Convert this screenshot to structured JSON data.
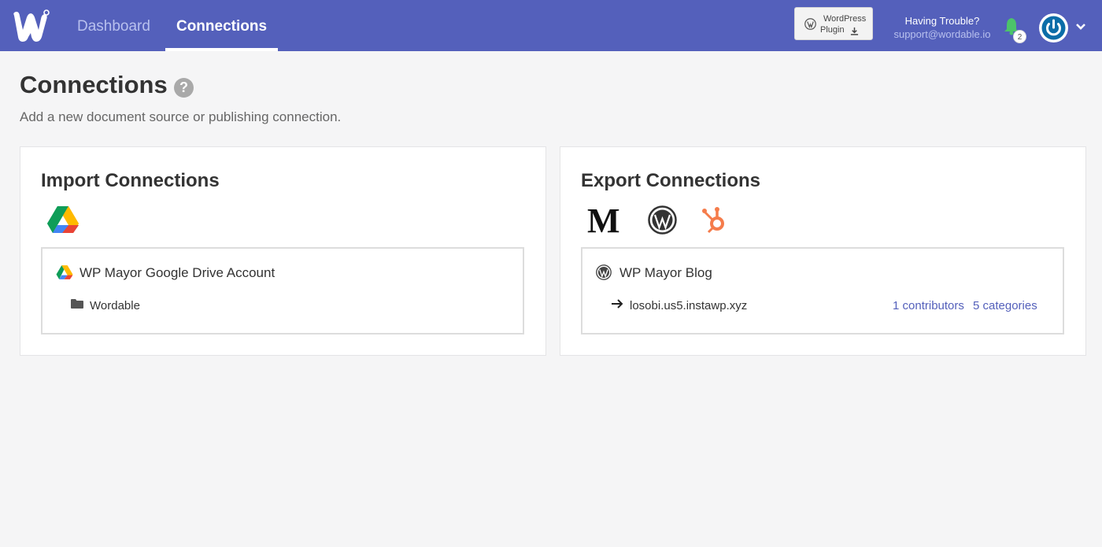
{
  "nav": {
    "tabs": [
      {
        "label": "Dashboard",
        "active": false
      },
      {
        "label": "Connections",
        "active": true
      }
    ],
    "wp_plugin": {
      "line1": "WordPress",
      "line2": "Plugin"
    },
    "trouble": {
      "title": "Having Trouble?",
      "email": "support@wordable.io"
    },
    "notifications": {
      "count": "2",
      "icon": "bell-icon"
    },
    "avatar_icon": "power-icon",
    "colors": {
      "bar": "#5460bb",
      "inactive_tab": "#b8c0ee",
      "bell": "#4cc46a"
    }
  },
  "page": {
    "title": "Connections",
    "subtitle": "Add a new document source or publishing connection."
  },
  "import": {
    "title": "Import Connections",
    "providers": [
      "google-drive-icon"
    ],
    "connection": {
      "name": "WP Mayor Google Drive Account",
      "folder": "Wordable"
    }
  },
  "export": {
    "title": "Export Connections",
    "providers": [
      "medium-icon",
      "wordpress-icon",
      "hubspot-icon"
    ],
    "connection": {
      "name": "WP Mayor Blog",
      "site": "losobi.us5.instawp.xyz",
      "contributors": "1 contributors",
      "categories": "5 categories"
    }
  }
}
